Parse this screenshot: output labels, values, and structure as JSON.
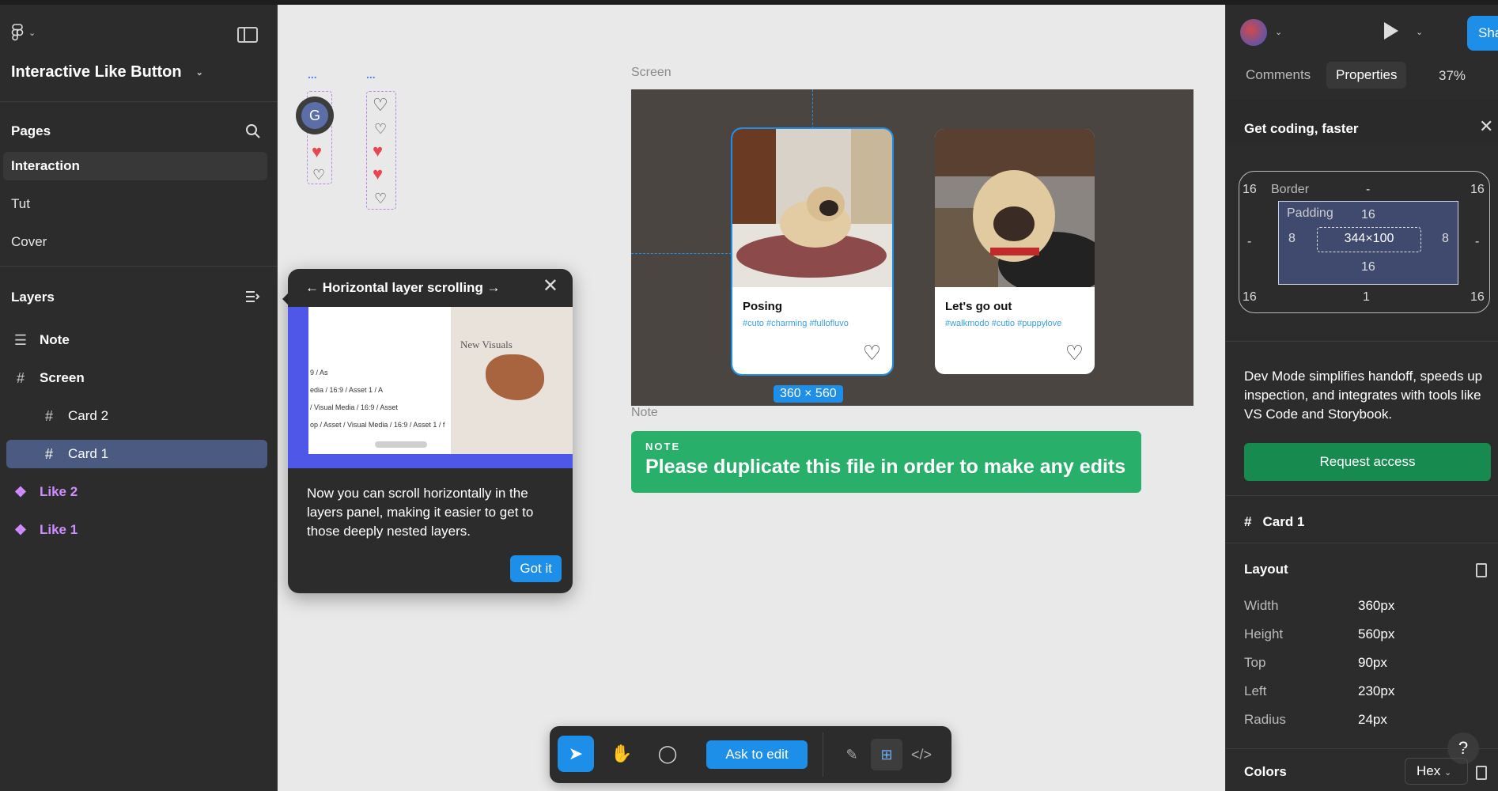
{
  "app": {
    "file_title": "Interactive Like Button",
    "logo": "figma-logo-icon"
  },
  "pages": {
    "title": "Pages",
    "items": [
      {
        "label": "Interaction",
        "active": true
      },
      {
        "label": "Tut"
      },
      {
        "label": "Cover"
      }
    ]
  },
  "layers": {
    "title": "Layers",
    "items": [
      {
        "label": "Note",
        "icon": "text-layer-icon"
      },
      {
        "label": "Screen",
        "icon": "frame-icon"
      },
      {
        "label": "Card 2",
        "icon": "frame-icon"
      },
      {
        "label": "Card 1",
        "icon": "frame-icon",
        "selected": true
      },
      {
        "label": "Like 2",
        "icon": "component-icon"
      },
      {
        "label": "Like 1",
        "icon": "component-icon"
      }
    ]
  },
  "canvas": {
    "mini_labels": [
      "...",
      "..."
    ],
    "avatar_initial": "G",
    "screen_label": "Screen",
    "cards": [
      {
        "title": "Posing",
        "tags": "#cuto  #charming  #fullofluvo"
      },
      {
        "title": "Let's go out",
        "tags": "#walkmodo  #cutio  #puppylove"
      }
    ],
    "dim_badge": "360 × 560",
    "note_label": "Note",
    "note_tag": "NOTE",
    "note_text": "Please duplicate this file in order to make any edits"
  },
  "popover": {
    "title": "← Horizontal layer scrolling →",
    "body": "Now you can scroll horizontally in the layers panel, making it easier to get to those deeply nested layers.",
    "button": "Got it",
    "img_lines": [
      "9 / As",
      "edia / 16:9 / Asset 1 / A",
      "/ Visual Media / 16:9 / Asset",
      "op / Asset / Visual Media / 16:9 / Asset 1 / f"
    ],
    "img_heading": "New Visuals"
  },
  "toolbar": {
    "ask_label": "Ask to edit",
    "tools": [
      "move-tool-icon",
      "hand-tool-icon",
      "comment-tool-icon"
    ],
    "modes": [
      "draw-mode-icon",
      "design-mode-icon",
      "dev-mode-icon"
    ]
  },
  "right": {
    "share_label": "Share",
    "tabs": [
      "Comments",
      "Properties"
    ],
    "zoom": "37%",
    "banner_title": "Get coding, faster",
    "box": {
      "border_label": "Border",
      "border_val": "-",
      "padding_label": "Padding",
      "pad_top": "16",
      "pad_bottom": "16",
      "pad_left": "8",
      "pad_right": "8",
      "size": "344×100",
      "corner_tl": "16",
      "corner_tr": "16",
      "corner_bl": "16",
      "corner_br": "16",
      "side_left": "-",
      "side_right": "-",
      "bottom_val": "1"
    },
    "description": "Dev Mode simplifies handoff, speeds up inspection, and integrates with tools like VS Code and Storybook.",
    "request_label": "Request access",
    "selection_name": "Card 1",
    "layout_title": "Layout",
    "props": [
      {
        "label": "Width",
        "value": "360px"
      },
      {
        "label": "Height",
        "value": "560px"
      },
      {
        "label": "Top",
        "value": "90px"
      },
      {
        "label": "Left",
        "value": "230px"
      },
      {
        "label": "Radius",
        "value": "24px"
      }
    ],
    "colors_title": "Colors",
    "color_format": "Hex",
    "help": "?"
  },
  "colors": {
    "accent": "#1e8fe8",
    "note_green": "#28b06a",
    "component_purple": "#d18cff",
    "heart_red": "#e8474f"
  }
}
